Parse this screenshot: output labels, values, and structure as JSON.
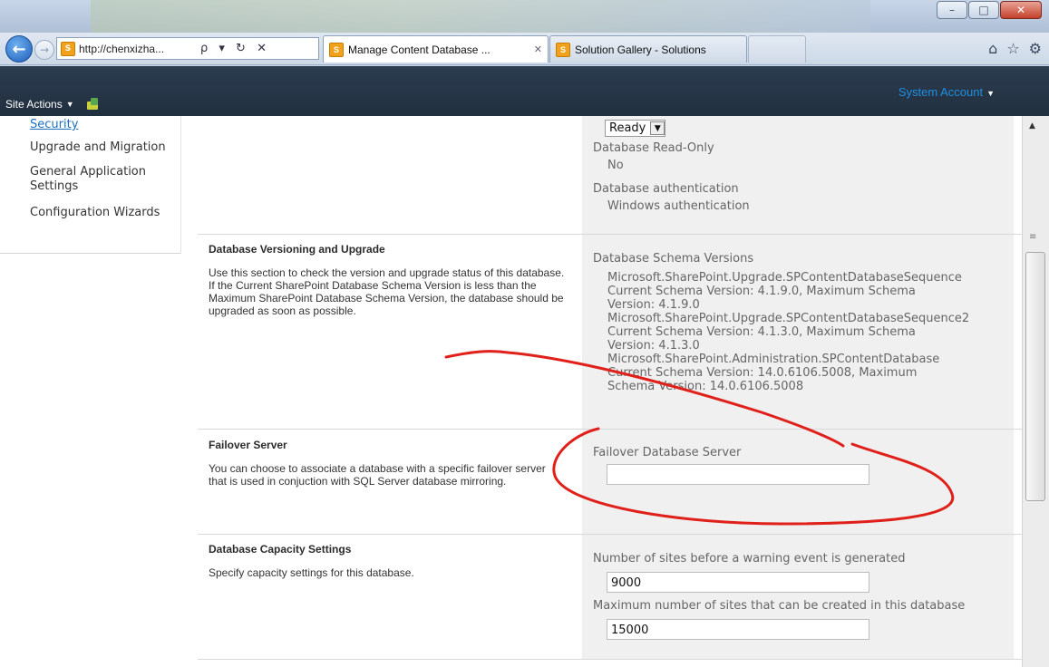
{
  "browser": {
    "address_url": "http://chenxizha...",
    "address_tools": "ρ ▾ ↻ ✕",
    "tabs": [
      {
        "label": "Manage Content Database ...",
        "active": true,
        "close": "✕"
      },
      {
        "label": "Solution Gallery - Solutions",
        "active": false
      }
    ],
    "window_buttons": [
      "–",
      "□",
      "✕"
    ],
    "right_icons": [
      "home-icon",
      "star-icon",
      "gear-icon"
    ]
  },
  "ribbon": {
    "site_actions": "Site Actions",
    "system_account": "System Account",
    "colors": {
      "bar": "#21303f",
      "account_link": "#1e8fe0"
    }
  },
  "left_nav": {
    "items": [
      {
        "label": "Security",
        "link": true
      },
      {
        "label": "Upgrade and Migration"
      },
      {
        "label": "General Application Settings"
      },
      {
        "label": "Configuration Wizards"
      }
    ]
  },
  "top_section": {
    "status_value": "Ready",
    "read_only_label": "Database Read-Only",
    "read_only_value": "No",
    "auth_label": "Database authentication",
    "auth_value": "Windows authentication"
  },
  "versioning": {
    "title": "Database Versioning and Upgrade",
    "description": "Use this section to check the version and upgrade status of this database. If the Current SharePoint Database Schema Version is less than the Maximum SharePoint Database Schema Version, the database should be upgraded as soon as possible.",
    "schema_label": "Database Schema Versions",
    "schema_lines": [
      "Microsoft.SharePoint.Upgrade.SPContentDatabaseSequence",
      "Current Schema Version: 4.1.9.0, Maximum Schema",
      "Version: 4.1.9.0",
      "Microsoft.SharePoint.Upgrade.SPContentDatabaseSequence2",
      "Current Schema Version: 4.1.3.0, Maximum Schema",
      "Version: 4.1.3.0",
      "Microsoft.SharePoint.Administration.SPContentDatabase",
      "Current Schema Version: 14.0.6106.5008, Maximum",
      "Schema Version: 14.0.6106.5008"
    ]
  },
  "failover": {
    "title": "Failover Server",
    "description": "You can choose to associate a database with a specific failover server that is used in conjuction with SQL Server database mirroring.",
    "field_label": "Failover Database Server",
    "field_value": ""
  },
  "capacity": {
    "title": "Database Capacity Settings",
    "description": "Specify capacity settings for this database.",
    "warning_label": "Number of sites before a warning event is generated",
    "warning_value": "9000",
    "max_label": "Maximum number of sites that can be created in this database",
    "max_value": "15000"
  },
  "annotation": {
    "color": "#e0201a"
  }
}
